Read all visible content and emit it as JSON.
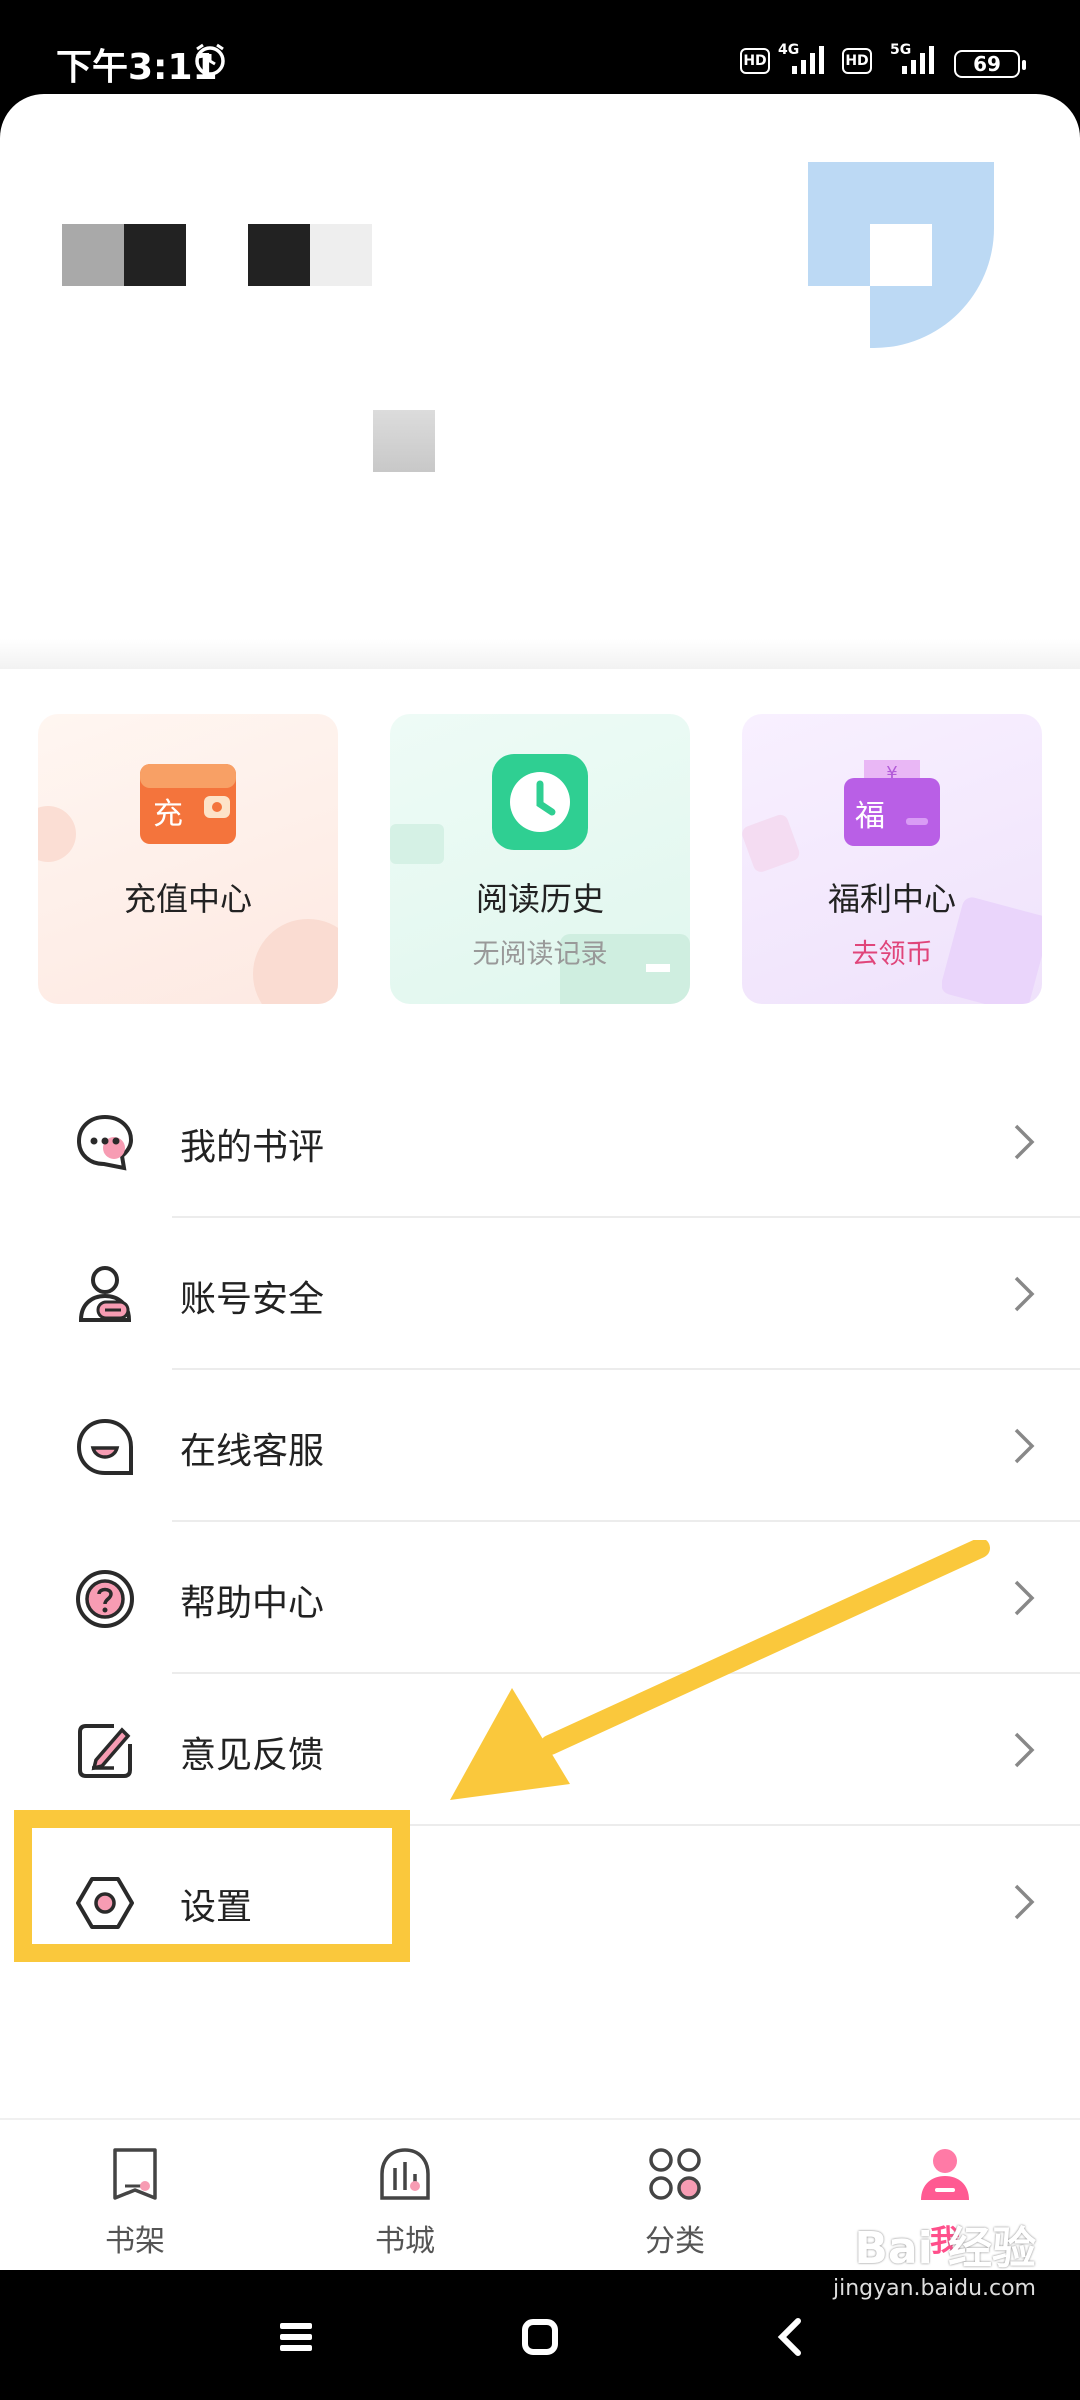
{
  "status_bar": {
    "time": "下午3:11",
    "hd1": "HD",
    "net1": "4G",
    "hd2": "HD",
    "net2": "5G",
    "battery": "69"
  },
  "cards": [
    {
      "title": "充值中心",
      "subtitle": "",
      "icon": "recharge-wallet-icon",
      "icon_text": "充"
    },
    {
      "title": "阅读历史",
      "subtitle": "无阅读记录",
      "icon": "clock-icon"
    },
    {
      "title": "福利中心",
      "subtitle": "去领币",
      "icon": "gift-coupon-icon",
      "icon_text": "福"
    }
  ],
  "menu": [
    {
      "label": "我的书评",
      "icon": "comment-bubble-icon"
    },
    {
      "label": "账号安全",
      "icon": "user-shield-icon"
    },
    {
      "label": "在线客服",
      "icon": "service-smile-icon"
    },
    {
      "label": "帮助中心",
      "icon": "help-question-icon"
    },
    {
      "label": "意见反馈",
      "icon": "feedback-edit-icon"
    },
    {
      "label": "设置",
      "icon": "settings-hexagon-icon"
    }
  ],
  "tabs": [
    {
      "label": "书架",
      "icon": "bookshelf-icon",
      "active": false
    },
    {
      "label": "书城",
      "icon": "bookstore-icon",
      "active": false
    },
    {
      "label": "分类",
      "icon": "category-grid-icon",
      "active": false
    },
    {
      "label": "我",
      "icon": "profile-person-icon",
      "active": true
    }
  ],
  "watermark": {
    "main": "Bai 经验",
    "sub": "jingyan.baidu.com"
  },
  "colors": {
    "accent": "#ff4f8b",
    "highlight": "#fac83c"
  }
}
